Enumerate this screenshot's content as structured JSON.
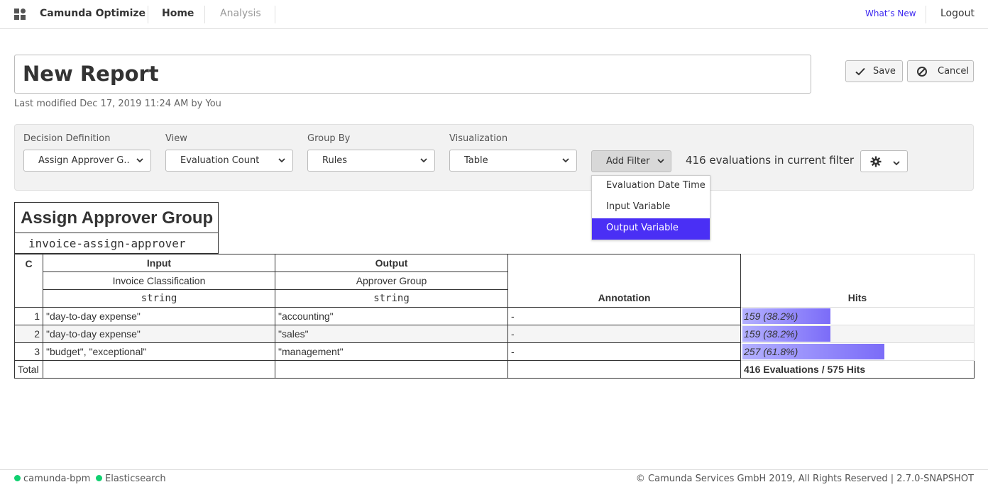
{
  "header": {
    "app_title": "Camunda Optimize",
    "nav": [
      "Home",
      "Analysis"
    ],
    "whats_new": "What’s New",
    "logout": "Logout"
  },
  "report": {
    "title": "New Report",
    "last_modified": "Last modified Dec 17, 2019 11:24 AM by You",
    "save_label": "Save",
    "cancel_label": "Cancel"
  },
  "controls": {
    "decision_definition": {
      "label": "Decision Definition",
      "value": "Assign Approver G..."
    },
    "view": {
      "label": "View",
      "value": "Evaluation Count"
    },
    "group_by": {
      "label": "Group By",
      "value": "Rules"
    },
    "visualization": {
      "label": "Visualization",
      "value": "Table"
    },
    "add_filter": "Add Filter",
    "eval_count": "416 evaluations in current filter",
    "filter_menu": [
      "Evaluation Date Time",
      "Input Variable",
      "Output Variable"
    ],
    "filter_menu_active": 2
  },
  "decision_table": {
    "name": "Assign Approver Group",
    "id": "invoice-assign-approver",
    "col_policy": "C",
    "input_header": "Input",
    "input_label": "Invoice Classification",
    "input_type": "string",
    "output_header": "Output",
    "output_label": "Approver Group",
    "output_type": "string",
    "annotation_header": "Annotation",
    "hits_header": "Hits",
    "rows": [
      {
        "num": "1",
        "input": "\"day-to-day expense\"",
        "output": "\"accounting\"",
        "annotation": "-",
        "hits": "159 (38.2%)",
        "hits_fraction": 0.382
      },
      {
        "num": "2",
        "input": "\"day-to-day expense\"",
        "output": "\"sales\"",
        "annotation": "-",
        "hits": "159 (38.2%)",
        "hits_fraction": 0.382
      },
      {
        "num": "3",
        "input": "\"budget\", \"exceptional\"",
        "output": "\"management\"",
        "annotation": "-",
        "hits": "257 (61.8%)",
        "hits_fraction": 0.618
      }
    ],
    "total_label": "Total",
    "total_value": "416 Evaluations / 575 Hits"
  },
  "footer": {
    "status": [
      "camunda-bpm",
      "Elasticsearch"
    ],
    "status_color": "#10d070",
    "copyright": "© Camunda Services GmbH 2019, All Rights Reserved | 2.7.0-SNAPSHOT"
  },
  "colors": {
    "accent": "#4a2ff5",
    "link": "#3c28f0"
  }
}
